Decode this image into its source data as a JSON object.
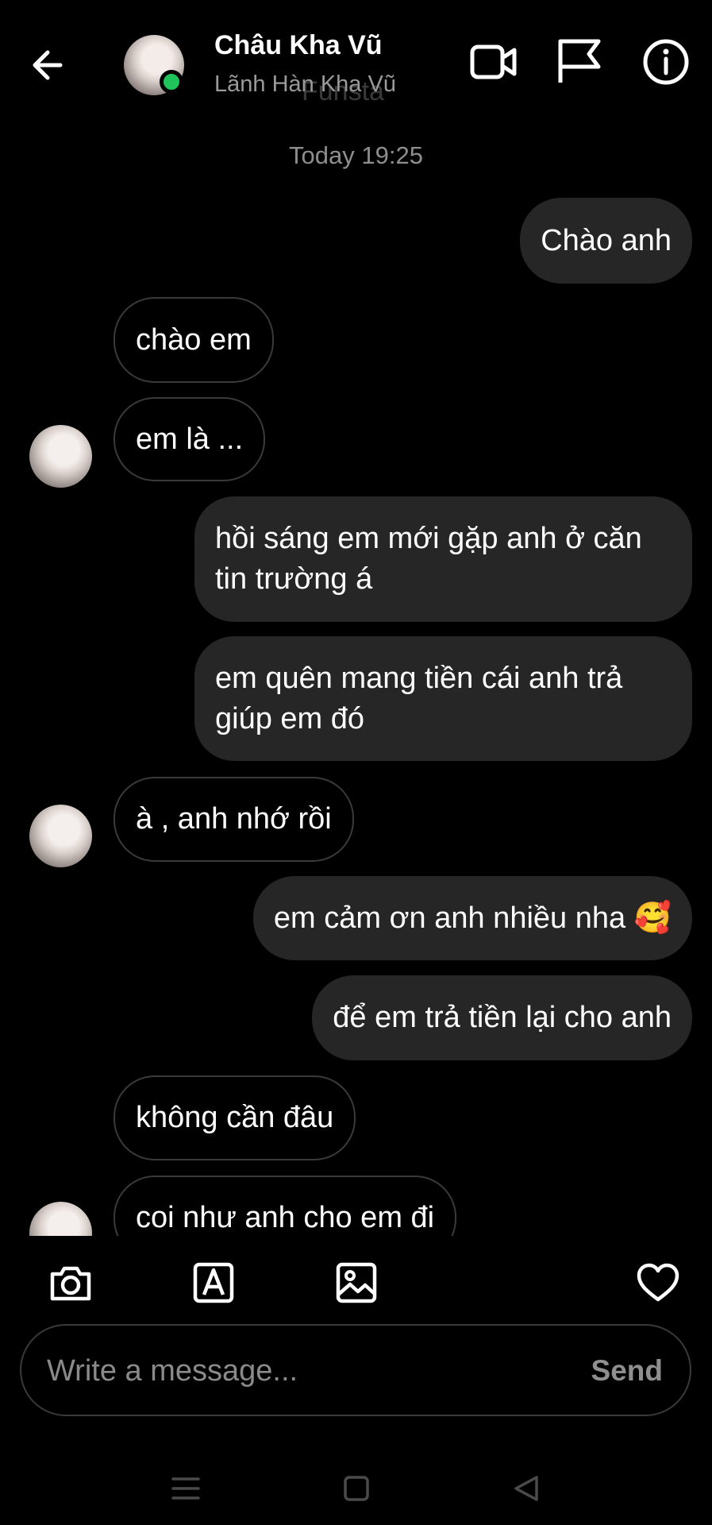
{
  "header": {
    "name": "Châu Kha Vũ",
    "subtitle": "Lãnh Hàn Kha Vũ",
    "ghost_text": "Funsta",
    "icons": [
      "back-arrow-icon",
      "video-call-icon",
      "flag-icon",
      "info-icon"
    ]
  },
  "chat": {
    "timestamp": "Today 19:25",
    "messages": [
      {
        "from": "me",
        "text": "Chào anh"
      },
      {
        "from": "them",
        "text": "chào em"
      },
      {
        "from": "them",
        "text": "em là ..."
      },
      {
        "from": "me",
        "text": "hồi sáng em mới gặp anh ở căn tin trường á"
      },
      {
        "from": "me",
        "text": "em quên mang tiền cái anh trả giúp em đó"
      },
      {
        "from": "them",
        "text": "à , anh nhớ rồi"
      },
      {
        "from": "me",
        "text": "em cảm ơn anh nhiều nha 🥰"
      },
      {
        "from": "me",
        "text": "để em trả tiền lại cho anh"
      },
      {
        "from": "them",
        "text": "không cần đâu"
      },
      {
        "from": "them",
        "text": "coi như anh cho em đi"
      }
    ]
  },
  "toolbar": {
    "icons": [
      "camera-icon",
      "text-style-icon",
      "gallery-icon",
      "heart-icon"
    ]
  },
  "composer": {
    "placeholder": "Write a message...",
    "send_label": "Send"
  },
  "navbar": {
    "icons": [
      "menu-icon",
      "home-square-icon",
      "back-triangle-icon"
    ]
  },
  "colors": {
    "background": "#000000",
    "sent_bubble": "#262626",
    "received_border": "#3a3a3a",
    "online_dot": "#21c45a",
    "muted_text": "#8e8e8e"
  }
}
